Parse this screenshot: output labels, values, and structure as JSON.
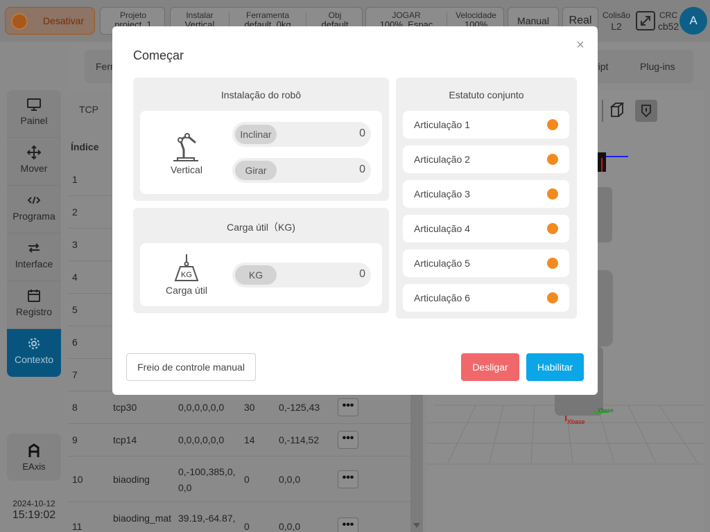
{
  "topbar": {
    "deactivate_label": "Desativar",
    "project_label": "Projeto",
    "project_value": "project_1",
    "install_label": "Instalar",
    "install_value": "Vertical",
    "tool_label": "Ferramenta",
    "tool_value": "default  0kg",
    "obj_label": "Obj",
    "obj_value": "default",
    "jog_label": "JOGAR",
    "jog_value": "100%  Espac",
    "speed_label": "Velocidade",
    "speed_value": "100%",
    "manual_label": "Manual",
    "real_label": "Real",
    "collision_label": "Colisão",
    "collision_value": "L2",
    "crc_label": "CRC",
    "crc_value": "cb52",
    "avatar_letter": "A"
  },
  "sidebar": {
    "items": [
      {
        "label": "Painel",
        "icon": "monitor-icon"
      },
      {
        "label": "Mover",
        "icon": "move-icon"
      },
      {
        "label": "Programa",
        "icon": "code-icon"
      },
      {
        "label": "Interface",
        "icon": "swap-icon"
      },
      {
        "label": "Registro",
        "icon": "calendar-icon"
      },
      {
        "label": "Contexto",
        "icon": "gear-icon"
      }
    ],
    "eaxis_label": "EAxis",
    "date": "2024-10-12",
    "time": "15:19:02"
  },
  "background": {
    "tab_left": "Ferr",
    "tab_script": "ript",
    "tab_plugins": "Plug-ins",
    "tcp_tab": "TCP",
    "index_header": "Índice",
    "row_indices": [
      "1",
      "2",
      "3",
      "4",
      "5",
      "6",
      "7"
    ],
    "rows": [
      {
        "idx": "8",
        "name": "tcp30",
        "pose": "0,0,0,0,0,0",
        "mass": "30",
        "cog": "0,-125,43",
        "more": "•••"
      },
      {
        "idx": "9",
        "name": "tcp14",
        "pose": "0,0,0,0,0,0",
        "mass": "14",
        "cog": "0,-114,52",
        "more": "•••"
      },
      {
        "idx": "10",
        "name": "biaoding",
        "pose": "0,-100,385,0,",
        "pose2": "0,0",
        "mass": "0",
        "cog": "0,0,0",
        "more": "•••"
      },
      {
        "idx": "11",
        "name": "biaoding_mat",
        "pose": "39.19,-64.87,",
        "mass": "0",
        "cog": "0,0,0",
        "more": "•••"
      }
    ],
    "axis_x_label": "Xbase",
    "axis_y_label": "Ybase"
  },
  "modal": {
    "title": "Começar",
    "install": {
      "title": "Instalação do robô",
      "robot_caption": "Vertical",
      "tilt_label": "Inclinar",
      "tilt_value": "0",
      "rotate_label": "Girar",
      "rotate_value": "0"
    },
    "payload": {
      "title": "Carga útil（KG)",
      "icon_text": "KG",
      "caption": "Carga útil",
      "kg_label": "KG",
      "kg_value": "0"
    },
    "joints": {
      "title": "Estatuto conjunto",
      "status_color": "#f38a1f",
      "items": [
        "Articulação 1",
        "Articulação 2",
        "Articulação 3",
        "Articulação 4",
        "Articulação 5",
        "Articulação 6"
      ]
    },
    "brake_button": "Freio de controle manual",
    "off_button": "Desligar",
    "enable_button": "Habilitar",
    "colors": {
      "off": "#f0686a",
      "enable": "#0aa6e8"
    }
  }
}
